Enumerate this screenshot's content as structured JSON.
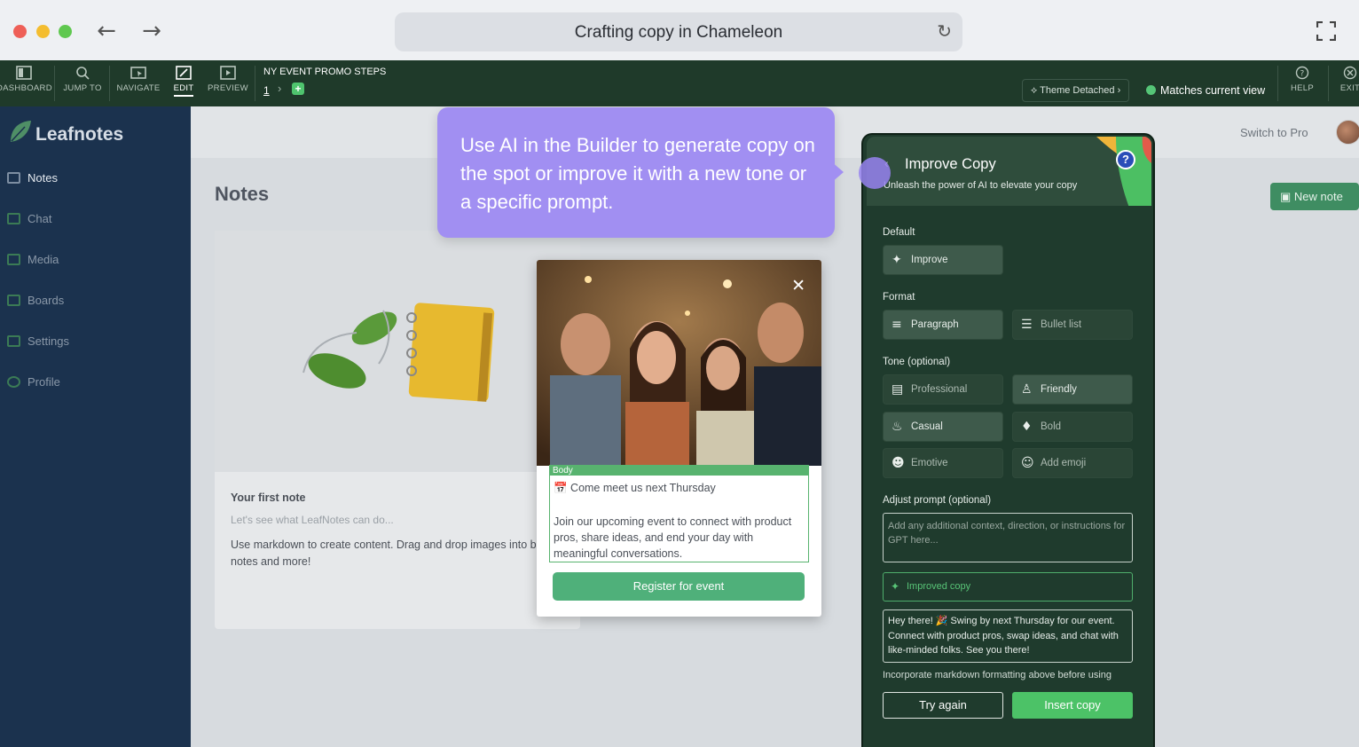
{
  "browser": {
    "title": "Crafting copy in Chameleon"
  },
  "toolbar": {
    "items": [
      {
        "label": "DASHBOARD"
      },
      {
        "label": "JUMP TO"
      },
      {
        "label": "NAVIGATE"
      },
      {
        "label": "EDIT"
      },
      {
        "label": "PREVIEW"
      },
      {
        "label": "HELP"
      },
      {
        "label": "EXIT"
      }
    ],
    "steps_title": "NY EVENT PROMO STEPS",
    "step_number": "1",
    "theme_label": "Theme Detached",
    "match_label": "Matches current view"
  },
  "app": {
    "logo": "Leafnotes",
    "sidebar": [
      "Notes",
      "Chat",
      "Media",
      "Boards",
      "Settings",
      "Profile"
    ],
    "switch_pro": "Switch to Pro",
    "page_title": "Notes",
    "new_note": "New note",
    "note": {
      "title": "Your first note",
      "subtitle": "Let's see what LeafNotes can do...",
      "body": "Use markdown to create content. Drag and drop images into body, link notes and more!"
    }
  },
  "modal": {
    "body_tag": "Body",
    "headline": "📅 Come meet us next Thursday",
    "text": "Join our upcoming event to connect with product pros, share ideas, and end your day with meaningful conversations.",
    "cta": "Register for event"
  },
  "tooltip": {
    "text": "Use AI in the Builder to generate copy on the spot or improve it with a new tone or a specific prompt."
  },
  "panel": {
    "title": "Improve Copy",
    "subtitle": "Unleash the power of AI to elevate your copy",
    "default_label": "Default",
    "improve": "Improve",
    "format_label": "Format",
    "paragraph": "Paragraph",
    "bullet": "Bullet list",
    "tone_label": "Tone (optional)",
    "tones": [
      "Professional",
      "Friendly",
      "Casual",
      "Bold",
      "Emotive",
      "Add emoji"
    ],
    "prompt_label": "Adjust prompt (optional)",
    "prompt_placeholder": "Add any additional context, direction, or instructions for GPT here...",
    "improved_label": "Improved copy",
    "improved_text": "Hey there! 🎉 Swing by next Thursday for our event. Connect with product pros, swap ideas, and chat with like-minded folks. See you there!",
    "markdown_note": "Incorporate markdown formatting above before using",
    "try_again": "Try again",
    "insert": "Insert copy"
  },
  "colors": {
    "toolbar_bg": "#1f3a2a",
    "sidebar_bg": "#1b324e",
    "tooltip_bg": "#a18ff2",
    "accent_green": "#4cc267"
  }
}
